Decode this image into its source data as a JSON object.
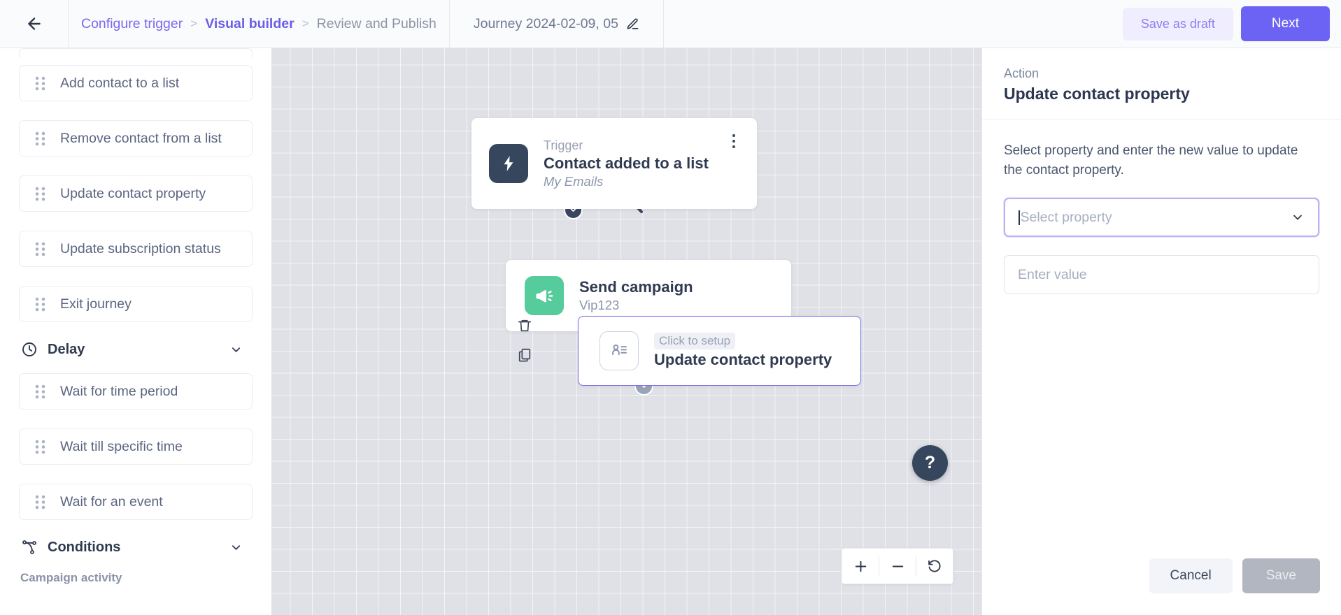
{
  "header": {
    "back_icon": "arrow-left-icon",
    "breadcrumbs": [
      {
        "label": "Configure trigger",
        "state": "link"
      },
      {
        "label": "Visual builder",
        "state": "active"
      },
      {
        "label": "Review and Publish",
        "state": "muted"
      }
    ],
    "separator": ">",
    "journey_title": "Journey 2024-02-09, 05",
    "edit_icon": "pencil-icon",
    "save_draft_label": "Save as draft",
    "next_label": "Next",
    "accent_color": "#6c63f5",
    "draft_bg_color": "#f0eefe"
  },
  "sidebar": {
    "actions": [
      {
        "label": "Add contact to a list"
      },
      {
        "label": "Remove contact from a list"
      },
      {
        "label": "Update contact property"
      },
      {
        "label": "Update subscription status"
      },
      {
        "label": "Exit journey"
      }
    ],
    "delay_group": {
      "label": "Delay",
      "icon": "clock-icon",
      "chevron": "chevron-down-icon"
    },
    "delay_items": [
      {
        "label": "Wait for time period"
      },
      {
        "label": "Wait till specific time"
      },
      {
        "label": "Wait for an event"
      }
    ],
    "conditions_group": {
      "label": "Conditions",
      "icon": "branch-icon",
      "chevron": "chevron-down-icon"
    },
    "campaign_activity_label": "Campaign activity",
    "drag_handle_icon": "drag-handle-icon"
  },
  "canvas": {
    "background_color": "#dfe1e6",
    "nodes": [
      {
        "id": "trigger",
        "kicker": "Trigger",
        "title": "Contact added to a list",
        "subtitle": "My Emails",
        "icon": "lightning-bolt-icon",
        "icon_color": "#36465c",
        "menu_icon": "more-vertical-icon"
      },
      {
        "id": "campaign",
        "title": "Send campaign",
        "subtitle": "Vip123",
        "icon": "megaphone-icon",
        "icon_color": "#56cc9d"
      },
      {
        "id": "update",
        "kicker": "Click to setup",
        "title": "Update contact property",
        "icon": "contact-record-icon",
        "selected": true,
        "selected_border_color": "#7b6ef0"
      }
    ],
    "node_tools": [
      {
        "icon": "trash-icon",
        "name": "delete-node-button"
      },
      {
        "icon": "copy-icon",
        "name": "duplicate-node-button"
      }
    ],
    "zoom_controls": [
      {
        "icon": "plus-icon",
        "name": "zoom-in-button"
      },
      {
        "icon": "minus-icon",
        "name": "zoom-out-button"
      },
      {
        "icon": "reset-icon",
        "name": "reset-view-button"
      }
    ],
    "help_label": "?"
  },
  "panel": {
    "kicker": "Action",
    "title": "Update contact property",
    "description": "Select property and enter the new value to update the contact property.",
    "property_select": {
      "placeholder": "Select property",
      "value": "",
      "chevron": "chevron-down-icon",
      "focused": true
    },
    "value_input": {
      "placeholder": "Enter value",
      "value": ""
    },
    "cancel_label": "Cancel",
    "save_label": "Save",
    "save_disabled": true
  }
}
